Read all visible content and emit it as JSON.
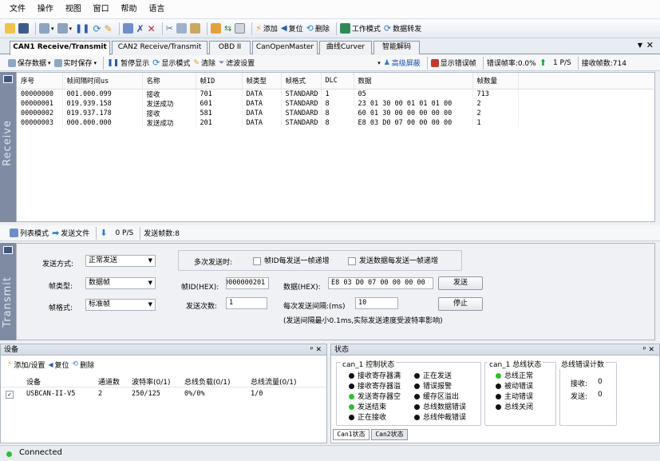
{
  "menu": [
    "文件",
    "操作",
    "视图",
    "窗口",
    "帮助",
    "语言"
  ],
  "toolbar": {
    "pause": "",
    "add": "添加",
    "reset": "复位",
    "delete": "删除",
    "work_mode": "工作模式",
    "forward": "数据转发"
  },
  "tabs": [
    "CAN1 Receive/Transmit",
    "CAN2 Receive/Transmit",
    "OBD II",
    "CanOpenMaster",
    "曲线Curver",
    "智能解码"
  ],
  "subbar": {
    "save_data": "保存数据",
    "realtime_save": "实时保存",
    "pause_display": "暂停显示",
    "display_mode": "显示模式",
    "clear": "清除",
    "filter": "滤波设置",
    "advanced": "高级屏蔽",
    "show_errors": "显示错误帧",
    "error_rate": "错误帧率:0.0%",
    "rate": "1 P/S",
    "recv_count": "接收帧数:714"
  },
  "receive": {
    "side_label": "Receive",
    "columns": [
      "序号",
      "帧间隔时间us",
      "名称",
      "帧ID",
      "帧类型",
      "帧格式",
      "DLC",
      "数据",
      "帧数量"
    ],
    "rows": [
      [
        "00000000",
        "001.000.099",
        "接收",
        "701",
        "DATA",
        "STANDARD",
        "1",
        "05",
        "713"
      ],
      [
        "00000001",
        "019.939.158",
        "发送成功",
        "601",
        "DATA",
        "STANDARD",
        "8",
        "23 01 30 00 01 01 01 00",
        "2"
      ],
      [
        "00000002",
        "019.937.178",
        "接收",
        "581",
        "DATA",
        "STANDARD",
        "8",
        "60 01 30 00 00 00 00 00",
        "2"
      ],
      [
        "00000003",
        "000.000.000",
        "发送成功",
        "201",
        "DATA",
        "STANDARD",
        "8",
        "E8 03 D0 07 00 00 00 00",
        "1"
      ]
    ]
  },
  "sendbar": {
    "list_mode": "列表模式",
    "send_file": "发送文件",
    "rate": "0 P/S",
    "send_count": "发送帧数:8"
  },
  "transmit": {
    "side_label": "Transmit",
    "send_mode_label": "发送方式:",
    "send_mode": "正常发送",
    "frame_type_label": "帧类型:",
    "frame_type": "数据帧",
    "frame_format_label": "帧格式:",
    "frame_format": "标准帧",
    "multi_label": "多次发送时:",
    "id_incr": "帧ID每发送一帧递增",
    "data_incr": "发送数据每发送一帧递增",
    "frame_id_label": "帧ID(HEX):",
    "frame_id": "0000000201",
    "data_label": "数据(HEX):",
    "data": "E8 03 D0 07 00 00 00 00",
    "send_btn": "发送",
    "count_label": "发送次数:",
    "count": "1",
    "interval_label": "每次发送间隔:(ms)",
    "interval": "10",
    "stop_btn": "停止",
    "note": "(发送间隔最小0.1ms,实际发送速度受波特率影响)"
  },
  "device": {
    "title": "设备",
    "pin": "ᵖ ✕",
    "add": "添加/设置",
    "reset": "复位",
    "delete": "删除",
    "columns": [
      "设备",
      "通道数",
      "波特率(0/1)",
      "总线负载(0/1)",
      "总线流量(0/1)"
    ],
    "rows": [
      [
        "USBCAN-II-V5",
        "2",
        "250/125",
        "0%/0%",
        "1/0"
      ]
    ]
  },
  "state": {
    "title": "状态",
    "ctrl_title": "can_1 控制状态",
    "ctrl_items": [
      {
        "label": "接收寄存器满",
        "color": "#111111"
      },
      {
        "label": "正在发送",
        "color": "#111111"
      },
      {
        "label": "接收寄存器溢",
        "color": "#111111"
      },
      {
        "label": "错误报警",
        "color": "#111111"
      },
      {
        "label": "发送寄存器空",
        "color": "#2fbf2f"
      },
      {
        "label": "缓存区溢出",
        "color": "#111111"
      },
      {
        "label": "发送结束",
        "color": "#2fbf2f"
      },
      {
        "label": "总线数据错误",
        "color": "#111111"
      },
      {
        "label": "正在接收",
        "color": "#111111"
      },
      {
        "label": "总线仲裁错误",
        "color": "#111111"
      }
    ],
    "bus_title": "can_1 总线状态",
    "bus_items": [
      {
        "label": "总线正常",
        "color": "#2fbf2f"
      },
      {
        "label": "被动错误",
        "color": "#111111"
      },
      {
        "label": "主动错误",
        "color": "#111111"
      },
      {
        "label": "总线关闭",
        "color": "#111111"
      }
    ],
    "err_title": "总线错误计数",
    "recv_label": "接收:",
    "recv_val": "0",
    "send_label": "发送:",
    "send_val": "0",
    "tabs": [
      "Can1状态",
      "Can2状态"
    ]
  },
  "statusbar": {
    "text": "Connected",
    "color": "#2fbf2f"
  }
}
